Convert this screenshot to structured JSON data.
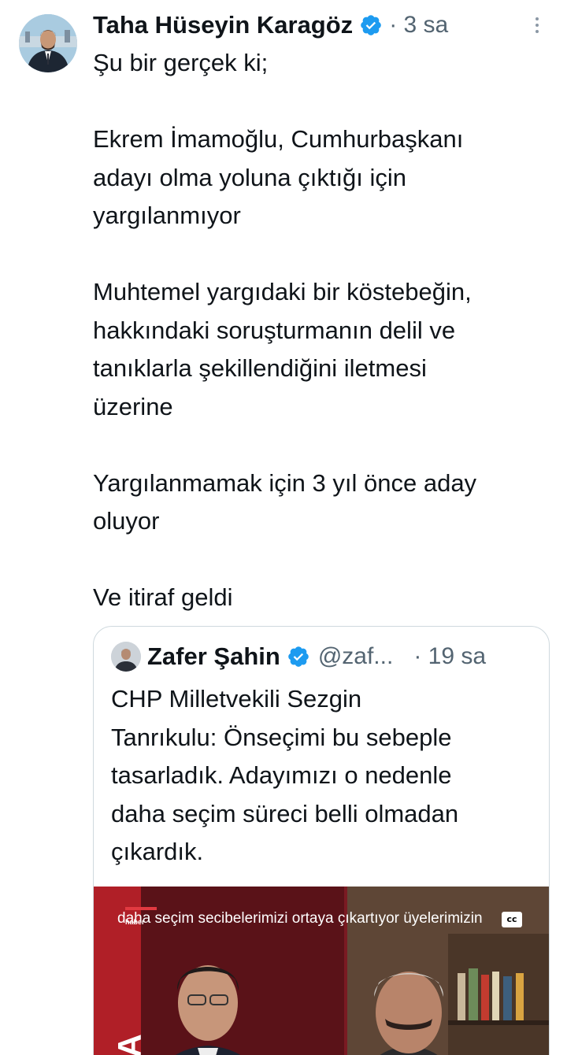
{
  "tweet": {
    "author_name": "Taha Hüseyin Karagöz",
    "time": "· 3 sa",
    "lines": [
      "Şu bir gerçek ki;",
      "",
      "Ekrem İmamoğlu, Cumhurbaşkanı",
      "adayı olma yoluna çıktığı için",
      "yargılanmıyor",
      "",
      "Muhtemel yargıdaki bir köstebeğin,",
      "hakkındaki soruşturmanın delil ve",
      "tanıklarla şekillendiğini iletmesi",
      "üzerine",
      "",
      "Yargılanmamak için 3 yıl önce aday",
      "oluyor",
      "",
      "Ve itiraf geldi"
    ]
  },
  "quote": {
    "author_name": "Zafer Şahin",
    "handle": "@zaf...",
    "time": "· 19 sa",
    "lines": [
      "CHP Milletvekili Sezgin",
      "Tanrıkulu: Önseçimi bu sebeple",
      "tasarladık. Adayımızı o nedenle",
      "daha seçim süreci belli olmadan",
      "çıkardık."
    ],
    "video": {
      "caption": "daha seçim secibelerimizi ortaya çıkartıyor üyelerimizin",
      "cc_label": "cc",
      "channel_tag": "haber"
    }
  },
  "colors": {
    "text": "#0f1419",
    "secondary": "#536471",
    "verified": "#1d9bf0",
    "border": "#cfd9de"
  },
  "icons": [
    "verified-badge-icon",
    "more-options-icon",
    "closed-captions-icon"
  ]
}
